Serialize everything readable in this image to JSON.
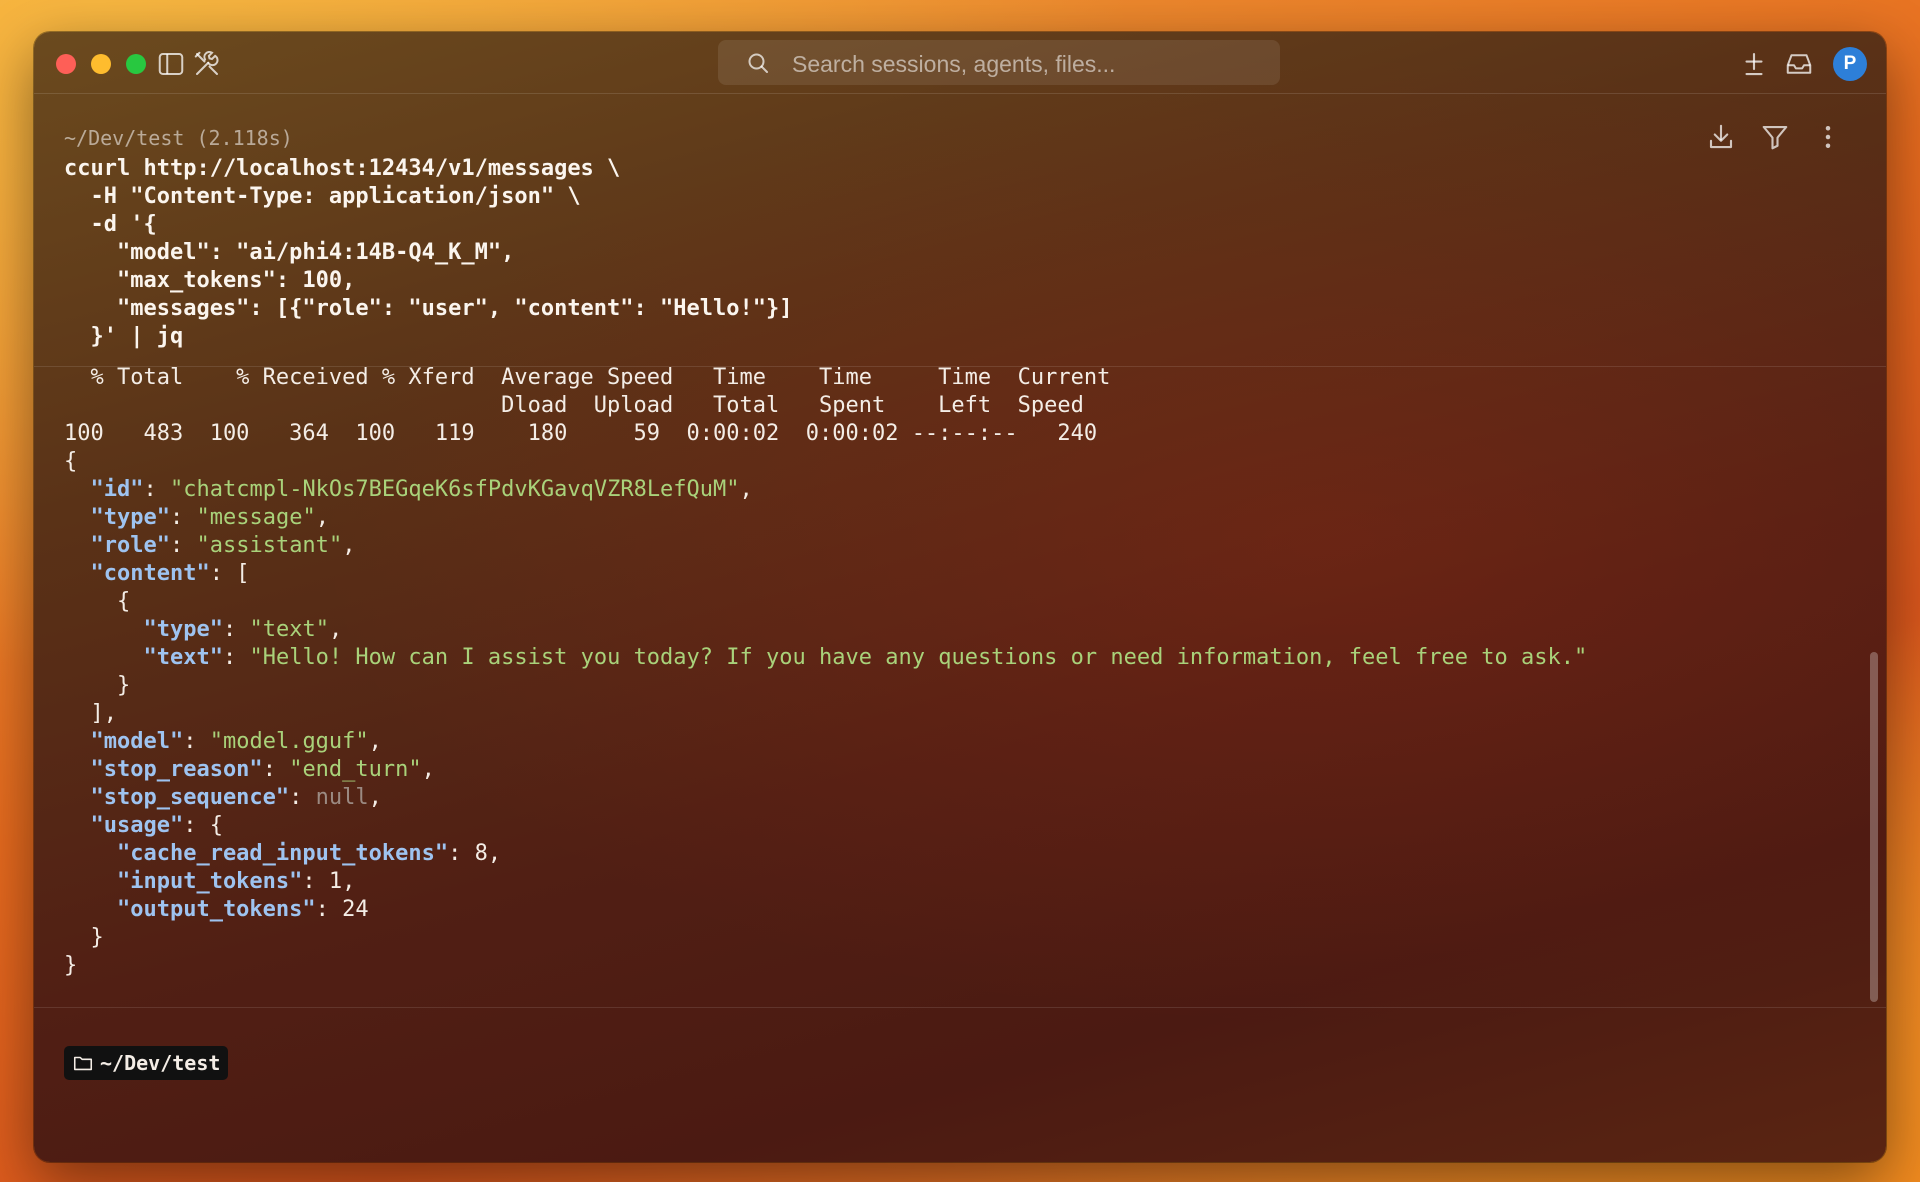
{
  "titlebar": {
    "search_placeholder": "Search sessions, agents, files...",
    "avatar_initial": "P",
    "icons": [
      "sidebar-toggle-icon",
      "tools-icon",
      "search-icon",
      "add-tab-icon",
      "inbox-icon"
    ]
  },
  "block": {
    "meta": "~/Dev/test (2.118s)",
    "command_lines": [
      "ccurl http://localhost:12434/v1/messages \\",
      "  -H \"Content-Type: application/json\" \\",
      "  -d '{",
      "    \"model\": \"ai/phi4:14B-Q4_K_M\",",
      "    \"max_tokens\": 100,",
      "    \"messages\": [{\"role\": \"user\", \"content\": \"Hello!\"}]",
      "  }' | jq"
    ],
    "curl_progress_lines": [
      "  % Total    % Received % Xferd  Average Speed   Time    Time     Time  Current",
      "                                 Dload  Upload   Total   Spent    Left  Speed",
      "100   483  100   364  100   119    180     59  0:00:02  0:00:02 --:--:--   240"
    ],
    "response": {
      "id": "chatcmpl-NkOs7BEGqeK6sfPdvKGavqVZR8LefQuM",
      "type": "message",
      "role": "assistant",
      "content_type": "text",
      "content_text": "Hello! How can I assist you today? If you have any questions or need information, feel free to ask.",
      "model": "model.gguf",
      "stop_reason": "end_turn",
      "stop_sequence": "null",
      "cache_read_input_tokens": "8",
      "input_tokens": "1",
      "output_tokens": "24"
    },
    "toolbar_icons": [
      "download-icon",
      "filter-icon",
      "more-icon"
    ]
  },
  "prompt": {
    "cwd": "~/Dev/test"
  },
  "colors": {
    "json_key": "#9ec3f0",
    "json_string": "#a9d27a",
    "avatar": "#2d7fd8"
  }
}
